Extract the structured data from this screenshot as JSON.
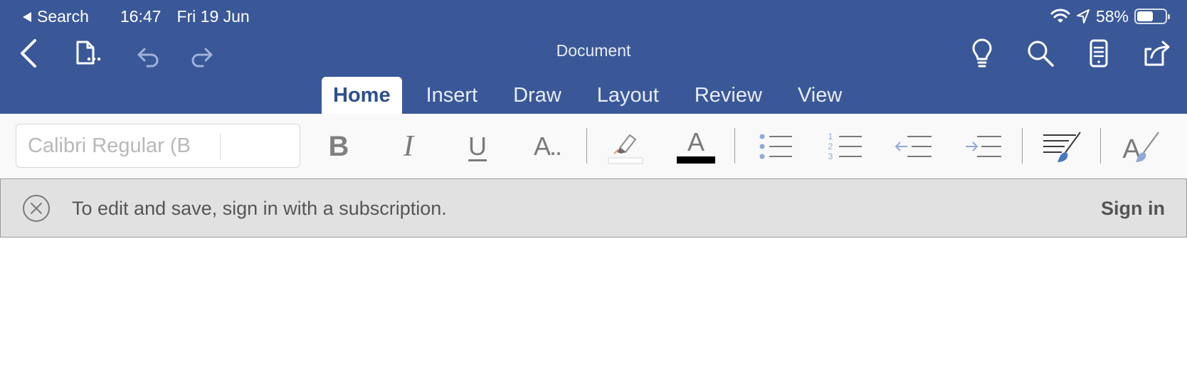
{
  "status_bar": {
    "back_app": "Search",
    "time": "16:47",
    "date": "Fri 19 Jun",
    "battery": "58%",
    "battery_level": 0.58
  },
  "toolbar": {
    "title": "Document",
    "icons": [
      "chevron-left-icon",
      "file-menu-icon",
      "undo-icon",
      "redo-icon",
      "lightbulb-icon",
      "search-icon",
      "mobile-view-icon",
      "share-icon"
    ]
  },
  "tabs": [
    {
      "label": "Home",
      "active": true
    },
    {
      "label": "Insert",
      "active": false
    },
    {
      "label": "Draw",
      "active": false
    },
    {
      "label": "Layout",
      "active": false
    },
    {
      "label": "Review",
      "active": false
    },
    {
      "label": "View",
      "active": false
    }
  ],
  "ribbon": {
    "font_name": "Calibri Regular (B",
    "bold": "B",
    "italic": "I",
    "underline": "U",
    "more_formatting": "A..",
    "font_color_letter": "A",
    "font_color": "#000000",
    "highlight_color": "#ffffff"
  },
  "banner": {
    "message": "To edit and save, sign in with a subscription.",
    "sign_in": "Sign in"
  },
  "colors": {
    "brand": "#3a5898",
    "accent_text": "#2f4f8f",
    "icon_blue": "#6a8fcf"
  }
}
